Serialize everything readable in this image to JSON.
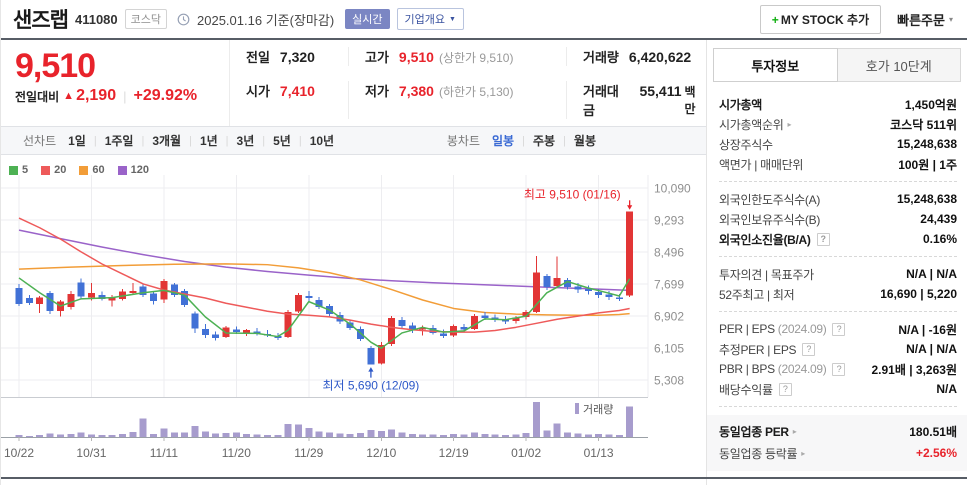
{
  "header": {
    "title": "샌즈랩",
    "code": "411080",
    "market_badge": "코스닥",
    "date_text": "2025.01.16 기준(장마감)",
    "realtime_badge": "실시간",
    "overview_button": "기업개요",
    "mystock_plus": "+",
    "mystock_label": "MY STOCK 추가",
    "quick_order": "빠른주문"
  },
  "price": {
    "current": "9,510",
    "change_label": "전일대비",
    "change": "2,190",
    "change_pct": "+29.92%",
    "up_color": "#e8232b"
  },
  "summary": {
    "cells": [
      {
        "name": "prev-close",
        "label": "전일",
        "value": "7,320"
      },
      {
        "name": "high",
        "label": "고가",
        "value": "9,510",
        "red": true,
        "extra": "(상한가 9,510)"
      },
      {
        "name": "volume",
        "label": "거래량",
        "value": "6,420,622"
      },
      {
        "name": "open",
        "label": "시가",
        "value": "7,410",
        "red": true
      },
      {
        "name": "low",
        "label": "저가",
        "value": "7,380",
        "red": true,
        "extra": "(하한가 5,130)"
      },
      {
        "name": "trade-value",
        "label": "거래대금",
        "value": "55,411",
        "unit": "백만"
      }
    ]
  },
  "toolbar": {
    "line_label": "선차트",
    "line_items": [
      {
        "label": "1일",
        "name": "period-1day"
      },
      {
        "label": "1주일",
        "name": "period-1week"
      },
      {
        "label": "3개월",
        "name": "period-3month"
      },
      {
        "label": "1년",
        "name": "period-1year"
      },
      {
        "label": "3년",
        "name": "period-3year"
      },
      {
        "label": "5년",
        "name": "period-5year"
      },
      {
        "label": "10년",
        "name": "period-10year"
      }
    ],
    "candle_label": "봉차트",
    "candle_items": [
      {
        "label": "일봉",
        "name": "candle-daily"
      },
      {
        "label": "주봉",
        "name": "candle-weekly"
      },
      {
        "label": "월봉",
        "name": "candle-monthly"
      }
    ],
    "selected": "일봉"
  },
  "chart_data": {
    "type": "candlestick",
    "title": "샌즈랩 일봉 차트",
    "y_ticks": [
      10090,
      9293,
      8496,
      7699,
      6902,
      6105,
      5308
    ],
    "x_ticks": [
      {
        "label": "10/22",
        "i": 0
      },
      {
        "label": "10/31",
        "i": 7
      },
      {
        "label": "11/11",
        "i": 14
      },
      {
        "label": "11/20",
        "i": 21
      },
      {
        "label": "11/29",
        "i": 28
      },
      {
        "label": "12/10",
        "i": 35
      },
      {
        "label": "12/19",
        "i": 42
      },
      {
        "label": "01/02",
        "i": 49
      },
      {
        "label": "01/13",
        "i": 56
      }
    ],
    "ma_periods": [
      {
        "label": "5",
        "color": "#4db153"
      },
      {
        "label": "20",
        "color": "#ee5a5a"
      },
      {
        "label": "60",
        "color": "#f29d38"
      },
      {
        "label": "120",
        "color": "#9a63c9"
      }
    ],
    "up_color": "#e23535",
    "down_color": "#4171d6",
    "volume_color": "#a79ccd",
    "volume_legend": "거래량",
    "candles": [
      [
        7600,
        7700,
        7150,
        7200,
        400
      ],
      [
        7350,
        7420,
        7180,
        7230,
        250
      ],
      [
        7200,
        7400,
        6980,
        7360,
        450
      ],
      [
        7480,
        7530,
        6950,
        7030,
        700
      ],
      [
        7030,
        7300,
        6890,
        7260,
        550
      ],
      [
        7120,
        7520,
        7060,
        7450,
        600
      ],
      [
        7740,
        7830,
        7330,
        7390,
        900
      ],
      [
        7360,
        7720,
        7290,
        7470,
        550
      ],
      [
        7430,
        7510,
        7290,
        7330,
        400
      ],
      [
        7290,
        7420,
        7140,
        7370,
        450
      ],
      [
        7330,
        7570,
        7290,
        7510,
        600
      ],
      [
        7470,
        7720,
        7430,
        7520,
        1100
      ],
      [
        7640,
        7710,
        7370,
        7430,
        3900
      ],
      [
        7460,
        7520,
        7190,
        7270,
        600
      ],
      [
        7310,
        7820,
        7230,
        7770,
        1800
      ],
      [
        7690,
        7720,
        7370,
        7430,
        900
      ],
      [
        7530,
        7570,
        7130,
        7180,
        1000
      ],
      [
        6960,
        7010,
        6480,
        6590,
        2300
      ],
      [
        6580,
        6700,
        6350,
        6430,
        1200
      ],
      [
        6440,
        6520,
        6290,
        6360,
        700
      ],
      [
        6380,
        6650,
        6350,
        6610,
        800
      ],
      [
        6570,
        6640,
        6450,
        6500,
        900
      ],
      [
        6480,
        6580,
        6400,
        6550,
        600
      ],
      [
        6520,
        6600,
        6420,
        6470,
        500
      ],
      [
        6450,
        6550,
        6380,
        6420,
        450
      ],
      [
        6400,
        6480,
        6300,
        6350,
        400
      ],
      [
        6380,
        7050,
        6350,
        7000,
        2800
      ],
      [
        7020,
        7480,
        6980,
        7420,
        2600
      ],
      [
        7400,
        7520,
        7280,
        7350,
        1900
      ],
      [
        7300,
        7380,
        7080,
        7130,
        1200
      ],
      [
        7150,
        7200,
        6880,
        6950,
        900
      ],
      [
        6930,
        7000,
        6700,
        6760,
        700
      ],
      [
        6740,
        6820,
        6550,
        6600,
        600
      ],
      [
        6580,
        6640,
        6280,
        6330,
        800
      ],
      [
        6100,
        6150,
        5690,
        5700,
        1500
      ],
      [
        5720,
        6250,
        5700,
        6180,
        1300
      ],
      [
        6200,
        6900,
        6150,
        6850,
        1600
      ],
      [
        6800,
        6880,
        6600,
        6650,
        900
      ],
      [
        6670,
        6740,
        6480,
        6540,
        600
      ],
      [
        6560,
        6660,
        6420,
        6620,
        550
      ],
      [
        6600,
        6680,
        6440,
        6480,
        500
      ],
      [
        6460,
        6560,
        6350,
        6400,
        450
      ],
      [
        6420,
        6690,
        6380,
        6650,
        600
      ],
      [
        6630,
        6700,
        6500,
        6560,
        500
      ],
      [
        6580,
        6950,
        6550,
        6900,
        900
      ],
      [
        6920,
        7000,
        6800,
        6850,
        600
      ],
      [
        6870,
        6940,
        6750,
        6800,
        500
      ],
      [
        6820,
        6900,
        6700,
        6760,
        450
      ],
      [
        6780,
        6900,
        6720,
        6860,
        550
      ],
      [
        6880,
        7050,
        6820,
        7000,
        800
      ],
      [
        7000,
        8400,
        6980,
        7990,
        7400
      ],
      [
        7900,
        7950,
        7550,
        7620,
        1400
      ],
      [
        7650,
        8380,
        7600,
        7850,
        2900
      ],
      [
        7800,
        7850,
        7560,
        7620,
        900
      ],
      [
        7640,
        7720,
        7480,
        7560,
        700
      ],
      [
        7580,
        7660,
        7440,
        7520,
        550
      ],
      [
        7500,
        7570,
        7350,
        7420,
        600
      ],
      [
        7440,
        7520,
        7300,
        7380,
        500
      ],
      [
        7360,
        7450,
        7280,
        7320,
        450
      ],
      [
        7410,
        9510,
        7380,
        9510,
        6420
      ]
    ],
    "ma_lines": {
      "5": [
        [
          0,
          7850
        ],
        [
          2,
          7480
        ],
        [
          4,
          7150
        ],
        [
          6,
          7330
        ],
        [
          9,
          7360
        ],
        [
          12,
          7480
        ],
        [
          14,
          7540
        ],
        [
          16,
          7420
        ],
        [
          18,
          6880
        ],
        [
          20,
          6480
        ],
        [
          23,
          6470
        ],
        [
          25,
          6390
        ],
        [
          26,
          6550
        ],
        [
          28,
          7260
        ],
        [
          30,
          7050
        ],
        [
          32,
          6700
        ],
        [
          34,
          6250
        ],
        [
          35,
          6100
        ],
        [
          37,
          6480
        ],
        [
          39,
          6620
        ],
        [
          41,
          6500
        ],
        [
          43,
          6530
        ],
        [
          45,
          6830
        ],
        [
          47,
          6810
        ],
        [
          49,
          6900
        ],
        [
          51,
          7480
        ],
        [
          53,
          7760
        ],
        [
          55,
          7600
        ],
        [
          57,
          7470
        ],
        [
          58,
          7400
        ],
        [
          59,
          7830
        ]
      ],
      "20": [
        [
          0,
          9340
        ],
        [
          2,
          9100
        ],
        [
          4,
          8820
        ],
        [
          6,
          8500
        ],
        [
          8,
          8200
        ],
        [
          10,
          7950
        ],
        [
          12,
          7700
        ],
        [
          14,
          7550
        ],
        [
          16,
          7450
        ],
        [
          18,
          7350
        ],
        [
          20,
          7220
        ],
        [
          22,
          7120
        ],
        [
          24,
          7020
        ],
        [
          26,
          6950
        ],
        [
          28,
          6920
        ],
        [
          30,
          6880
        ],
        [
          32,
          6800
        ],
        [
          34,
          6700
        ],
        [
          36,
          6620
        ],
        [
          38,
          6560
        ],
        [
          40,
          6520
        ],
        [
          42,
          6500
        ],
        [
          44,
          6500
        ],
        [
          46,
          6540
        ],
        [
          48,
          6620
        ],
        [
          50,
          6720
        ],
        [
          52,
          6820
        ],
        [
          54,
          6900
        ],
        [
          56,
          6980
        ],
        [
          58,
          7040
        ],
        [
          59,
          7090
        ]
      ],
      "60": [
        [
          0,
          8070
        ],
        [
          5,
          8120
        ],
        [
          10,
          8160
        ],
        [
          15,
          8190
        ],
        [
          20,
          8200
        ],
        [
          24,
          8180
        ],
        [
          27,
          8100
        ],
        [
          30,
          7980
        ],
        [
          33,
          7800
        ],
        [
          36,
          7560
        ],
        [
          39,
          7300
        ],
        [
          42,
          7090
        ],
        [
          45,
          6990
        ],
        [
          48,
          6950
        ],
        [
          51,
          6930
        ],
        [
          54,
          6920
        ],
        [
          56,
          6920
        ],
        [
          58,
          6940
        ],
        [
          59,
          6960
        ]
      ],
      "120": [
        [
          0,
          9040
        ],
        [
          4,
          8830
        ],
        [
          8,
          8620
        ],
        [
          12,
          8430
        ],
        [
          16,
          8260
        ],
        [
          20,
          8120
        ],
        [
          24,
          8010
        ],
        [
          28,
          7920
        ],
        [
          32,
          7840
        ],
        [
          36,
          7780
        ],
        [
          40,
          7730
        ],
        [
          44,
          7690
        ],
        [
          48,
          7650
        ],
        [
          52,
          7610
        ],
        [
          56,
          7570
        ],
        [
          59,
          7540
        ]
      ]
    },
    "annotations": {
      "high": {
        "text": "최고 9,510 (01/16)",
        "i": 59,
        "price": 9510,
        "color": "#e8232b"
      },
      "low": {
        "text": "최저 5,690 (12/09)",
        "i": 34,
        "price": 5690,
        "color": "#2d58c8"
      }
    }
  },
  "side_panel": {
    "tabs": [
      {
        "label": "투자정보",
        "name": "tab-invest-info",
        "active": true
      },
      {
        "label": "호가 10단계",
        "name": "tab-orderbook-10",
        "active": false
      }
    ],
    "sections": [
      {
        "rows": [
          {
            "name": "market-cap",
            "label": "시가총액",
            "bold": true,
            "value": "1,450억원"
          },
          {
            "name": "market-cap-rank",
            "label": "시가총액순위",
            "arrow": true,
            "value": "코스닥 511위"
          },
          {
            "name": "listed-shares",
            "label": "상장주식수",
            "value": "15,248,638"
          },
          {
            "name": "face-value-trade-unit",
            "label": "액면가 | 매매단위",
            "value": "100원 | 1주"
          }
        ]
      },
      {
        "rows": [
          {
            "name": "foreign-limit-shares",
            "label": "외국인한도주식수(A)",
            "value": "15,248,638"
          },
          {
            "name": "foreign-held-shares",
            "label": "외국인보유주식수(B)",
            "value": "24,439"
          },
          {
            "name": "foreign-exhaustion-rate",
            "label": "외국인소진율(B/A)",
            "bold": true,
            "help": true,
            "value": "0.16%"
          }
        ]
      },
      {
        "rows": [
          {
            "name": "opinion-target-price",
            "label": "투자의견 | 목표주가",
            "value": "N/A | N/A"
          },
          {
            "name": "week52-high-low",
            "label": "52주최고 | 최저",
            "value": "16,690 | 5,220"
          }
        ]
      },
      {
        "rows": [
          {
            "name": "per-eps",
            "label": "PER | EPS",
            "note": "(2024.09)",
            "help": true,
            "value": "N/A | -16원"
          },
          {
            "name": "est-per-eps",
            "label": "추정PER | EPS",
            "help": true,
            "value": "N/A | N/A"
          },
          {
            "name": "pbr-bps",
            "label": "PBR | BPS",
            "note": "(2024.09)",
            "help": true,
            "value": "2.91배 | 3,263원"
          },
          {
            "name": "dividend-yield",
            "label": "배당수익률",
            "help": true,
            "value": "N/A"
          }
        ]
      },
      {
        "highlight": true,
        "rows": [
          {
            "name": "industry-per",
            "label": "동일업종 PER",
            "arrow": true,
            "bold": true,
            "value": "180.51배"
          },
          {
            "name": "industry-change",
            "label": "동일업종 등락률",
            "arrow": true,
            "value": "+2.56%",
            "red": true
          }
        ]
      }
    ]
  }
}
